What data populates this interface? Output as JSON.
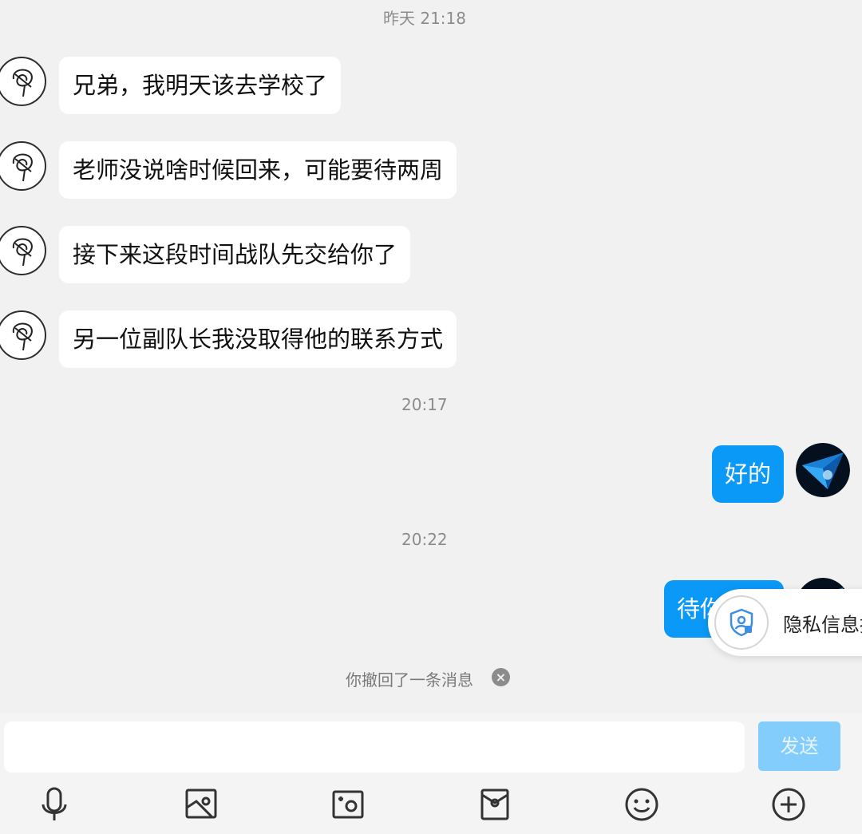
{
  "chat": {
    "timestamps": [
      "昨天 21:18",
      "20:17",
      "20:22"
    ],
    "incoming": [
      "兄弟，我明天该去学校了",
      "老师没说啥时候回来，可能要待两周",
      "接下来这段时间战队先交给你了",
      "另一位副队长我没取得他的联系方式"
    ],
    "outgoing": [
      "好的",
      "待你"
    ],
    "recall_notice": "你撤回了一条消息"
  },
  "privacy_popup": {
    "text": "隐私信息提"
  },
  "input": {
    "value": "",
    "send_label": "发送"
  },
  "toolbar": {
    "icons": [
      "microphone-icon",
      "image-icon",
      "camera-icon",
      "red-packet-icon",
      "emoji-icon",
      "plus-icon"
    ]
  },
  "colors": {
    "bubble_out": "#0a99f7",
    "send_disabled": "#82cdfb",
    "background": "#f1f1f1"
  }
}
